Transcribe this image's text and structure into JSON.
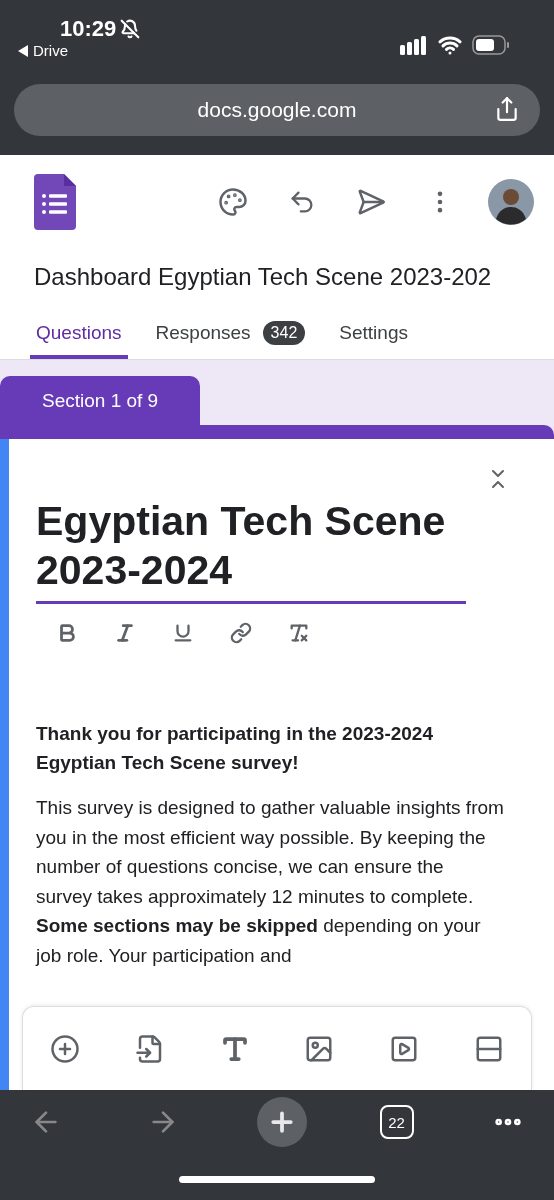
{
  "status_bar": {
    "time": "10:29",
    "back_app": "Drive"
  },
  "browser": {
    "url": "docs.google.com",
    "tab_count": "22"
  },
  "form": {
    "title": "Dashboard Egyptian Tech Scene 2023-202",
    "tabs": [
      {
        "label": "Questions",
        "selected": true
      },
      {
        "label": "Responses",
        "badge": "342",
        "selected": false
      },
      {
        "label": "Settings",
        "selected": false
      }
    ]
  },
  "section": {
    "label": "Section 1 of 9",
    "title": "Egyptian Tech Scene 2023-2024",
    "heading": "Thank you for participating in the 2023-2024 Egyptian Tech Scene survey!",
    "body": "This survey is designed to gather valuable insights from you in the most efficient way possible. By keeping the number of questions concise, we can ensure the survey takes approximately 12 minutes to complete. **Some sections may be skipped** depending on your job role. Your participation and"
  }
}
